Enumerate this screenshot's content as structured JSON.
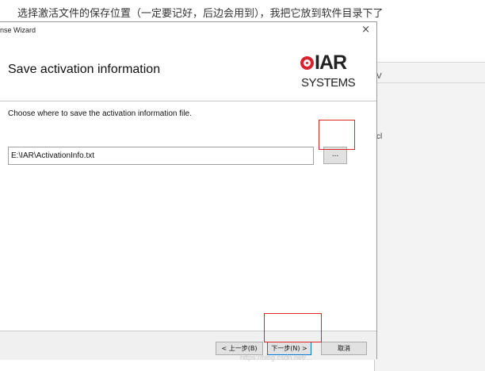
{
  "caption": "选择激活文件的保存位置（一定要记好，后边会用到），我把它放到软件目录下了",
  "dialog": {
    "title": "nse Wizard",
    "close_glyph": "×",
    "heading": "Save activation information",
    "logo": {
      "word": "IAR",
      "subtitle": "SYSTEMS",
      "accent": "#d9232e"
    },
    "instruction": "Choose where to save the activation information file.",
    "path_value": "E:\\IAR\\ActivationInfo.txt",
    "browse_label": "...",
    "buttons": {
      "back": "< 上一步(B)",
      "next": "下一步(N) >",
      "cancel": "取消"
    }
  },
  "background_window": {
    "glyph_v": "V",
    "glyph_c": "cl"
  },
  "watermark": "https://blog.csdn.net/...",
  "colors": {
    "highlight": "#e02424",
    "focus": "#0078d7"
  }
}
